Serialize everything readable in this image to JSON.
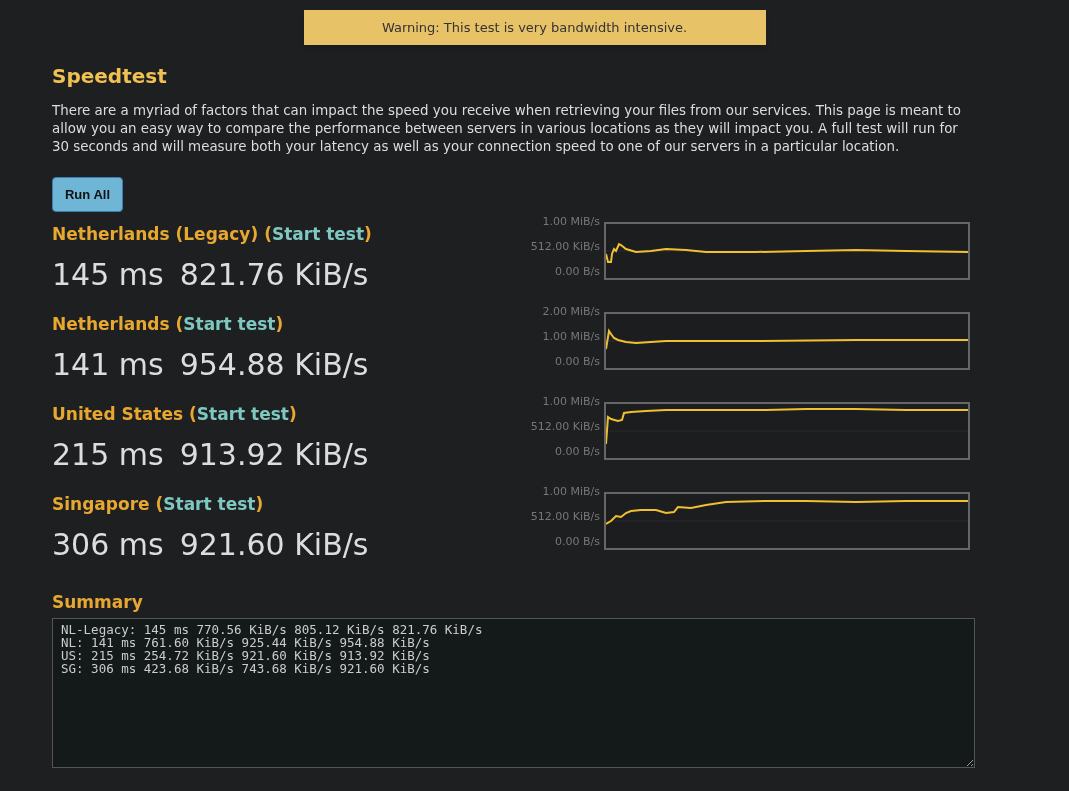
{
  "warning": "Warning: This test is very bandwidth intensive.",
  "title": "Speedtest",
  "intro": "There are a myriad of factors that can impact the speed you receive when retrieving your files from our services. This page is meant to allow you an easy way to compare the performance between servers in various locations as they will impact you. A full test will run for 30 seconds and will measure both your latency as well as your connection speed to one of our servers in a particular location.",
  "run_all": "Run All",
  "servers": [
    {
      "title": "Netherlands (Legacy) (",
      "link": "Start test",
      "after": ")",
      "latency": "145 ms",
      "speed": "821.76 KiB/s",
      "y_labels": [
        "1.00 MiB/s",
        "512.00 KiB/s",
        "0.00 B/s"
      ]
    },
    {
      "title": "Netherlands (",
      "link": "Start test",
      "after": ")",
      "latency": "141 ms",
      "speed": "954.88 KiB/s",
      "y_labels": [
        "2.00 MiB/s",
        "1.00 MiB/s",
        "0.00 B/s"
      ]
    },
    {
      "title": "United States (",
      "link": "Start test",
      "after": ")",
      "latency": "215 ms",
      "speed": "913.92 KiB/s",
      "y_labels": [
        "1.00 MiB/s",
        "512.00 KiB/s",
        "0.00 B/s"
      ]
    },
    {
      "title": "Singapore (",
      "link": "Start test",
      "after": ")",
      "latency": "306 ms",
      "speed": "921.60 KiB/s",
      "y_labels": [
        "1.00 MiB/s",
        "512.00 KiB/s",
        "0.00 B/s"
      ]
    }
  ],
  "summary_title": "Summary",
  "summary_lines": [
    "NL-Legacy: 145 ms 770.56 KiB/s 805.12 KiB/s 821.76 KiB/s",
    "NL: 141 ms 761.60 KiB/s 925.44 KiB/s 954.88 KiB/s",
    "US: 215 ms 254.72 KiB/s 921.60 KiB/s 913.92 KiB/s",
    "SG: 306 ms 423.68 KiB/s 743.68 KiB/s 921.60 KiB/s"
  ]
}
